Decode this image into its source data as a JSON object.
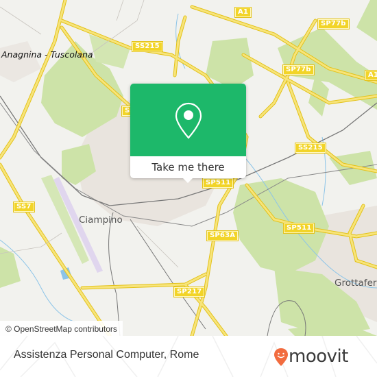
{
  "map": {
    "attribution": "© OpenStreetMap contributors",
    "place_labels": [
      {
        "name": "Anagnina - Tuscolana",
        "style": "italic"
      },
      {
        "name": "Ciampino",
        "style": "town"
      },
      {
        "name": "Grottaferr",
        "style": "town"
      }
    ],
    "road_shields": [
      {
        "id": "ss215-top",
        "label": "SS215"
      },
      {
        "id": "a1-top",
        "label": "A1"
      },
      {
        "id": "sp77b-top",
        "label": "SP77b"
      },
      {
        "id": "sp77b-mid",
        "label": "SP77b"
      },
      {
        "id": "a1-right",
        "label": "A1"
      },
      {
        "id": "ss-left-partial",
        "label": "SS"
      },
      {
        "id": "ss215-right",
        "label": "SS215"
      },
      {
        "id": "sp511-near",
        "label": "SP511"
      },
      {
        "id": "ss7",
        "label": "SS7"
      },
      {
        "id": "sp511-right",
        "label": "SP511"
      },
      {
        "id": "sp63a",
        "label": "SP63A"
      },
      {
        "id": "sp217",
        "label": "SP217"
      }
    ],
    "colors": {
      "background": "#f2f2ee",
      "park": "#cde3a8",
      "urban": "#e8e2dc",
      "road": "#f5dc5a",
      "water": "#8cc4e8",
      "rail": "#777777",
      "runway": "#e0d6ee"
    }
  },
  "popup": {
    "icon": "map-pin-icon",
    "action_label": "Take me there",
    "header_color": "#1db86a"
  },
  "footer": {
    "title": "Assistenza Personal Computer, Rome",
    "logo_text": "moovit",
    "logo_icon": "moovit-smile-pin-icon",
    "logo_color": "#f26c3f"
  }
}
